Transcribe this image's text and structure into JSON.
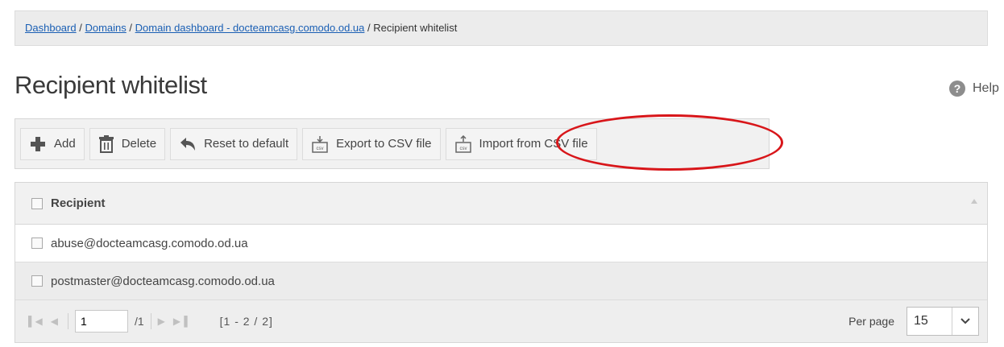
{
  "breadcrumb": {
    "links": [
      "Dashboard",
      "Domains",
      "Domain dashboard - docteamcasg.comodo.od.ua"
    ],
    "separator": "/",
    "current": "Recipient whitelist"
  },
  "page": {
    "title": "Recipient whitelist",
    "help_label": "Help",
    "help_icon": "?"
  },
  "toolbar": {
    "add_label": "Add",
    "delete_label": "Delete",
    "reset_label": "Reset to default",
    "export_label": "Export to CSV file",
    "import_label": "Import from CSV file",
    "highlight_color": "#d8161a"
  },
  "grid": {
    "column_header": "Recipient",
    "rows": [
      {
        "recipient": "abuse@docteamcasg.comodo.od.ua"
      },
      {
        "recipient": "postmaster@docteamcasg.comodo.od.ua"
      }
    ]
  },
  "pager": {
    "current_page": "1",
    "total_pages": "/1",
    "range": "[1 - 2 / 2]",
    "per_page_label": "Per page",
    "per_page_value": "15"
  },
  "colors": {
    "link": "#1a5fb4",
    "toolbar_bg": "#f1f1f1"
  }
}
